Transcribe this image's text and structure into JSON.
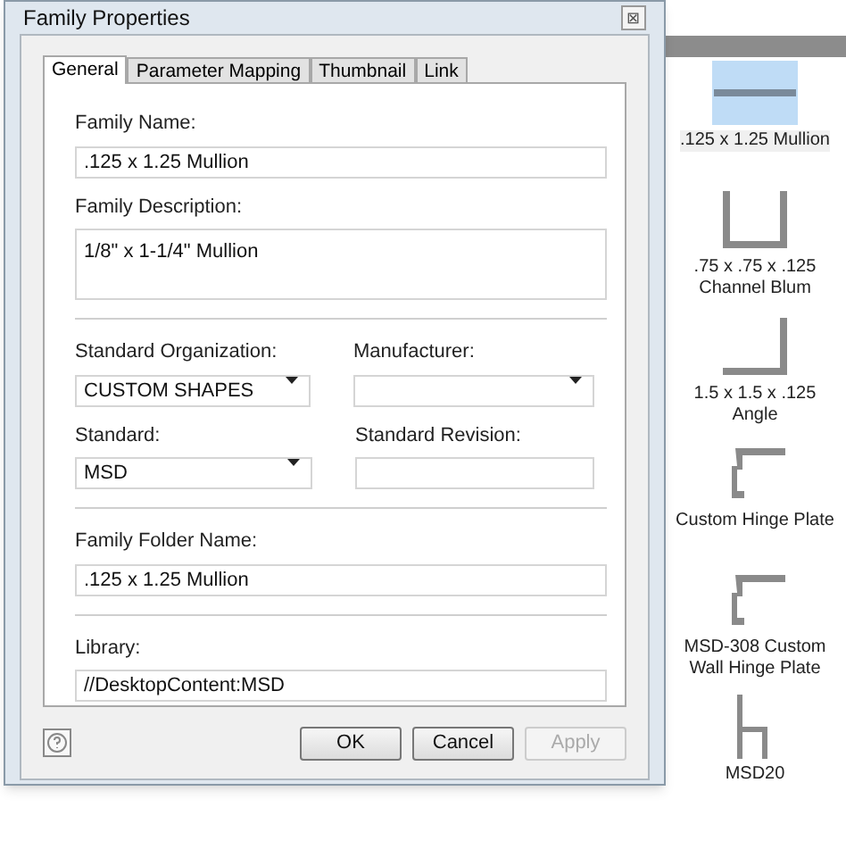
{
  "dialog": {
    "title": "Family Properties",
    "close": "⊠",
    "tabs": [
      {
        "label": "General",
        "selected": true
      },
      {
        "label": "Parameter Mapping",
        "selected": false
      },
      {
        "label": "Thumbnail",
        "selected": false
      },
      {
        "label": "Link",
        "selected": false
      }
    ],
    "family_name": {
      "label": "Family Name:",
      "value": ".125 x 1.25 Mullion"
    },
    "family_description": {
      "label": "Family Description:",
      "value": "1/8\" x 1-1/4\" Mullion"
    },
    "standard_organization": {
      "label": "Standard Organization:",
      "value": "CUSTOM SHAPES"
    },
    "manufacturer": {
      "label": "Manufacturer:"
    },
    "standard": {
      "label": "Standard:",
      "value": "MSD"
    },
    "standard_revision": {
      "label": "Standard Revision:"
    },
    "family_folder_name": {
      "label": "Family Folder Name:",
      "value": ".125 x 1.25 Mullion"
    },
    "library": {
      "label": "Library:",
      "value": "//DesktopContent:MSD"
    },
    "buttons": [
      {
        "label": "OK",
        "disabled": false
      },
      {
        "label": "Cancel",
        "disabled": false
      },
      {
        "label": "Apply",
        "disabled": true
      }
    ]
  },
  "library_items": [
    {
      "kind": "bar",
      "label": ".125 x 1.25 Mullion",
      "selected": true
    },
    {
      "kind": "channel",
      "label": ".75 x .75 x .125 Channel Blum",
      "selected": false
    },
    {
      "kind": "angle",
      "label": "1.5 x 1.5 x .125 Angle",
      "selected": false
    },
    {
      "kind": "hinge",
      "label": "Custom Hinge Plate",
      "selected": false
    },
    {
      "kind": "hinge",
      "label": "MSD-308 Custom Wall Hinge Plate",
      "selected": false
    },
    {
      "kind": "h",
      "label": "MSD20",
      "selected": false
    }
  ]
}
